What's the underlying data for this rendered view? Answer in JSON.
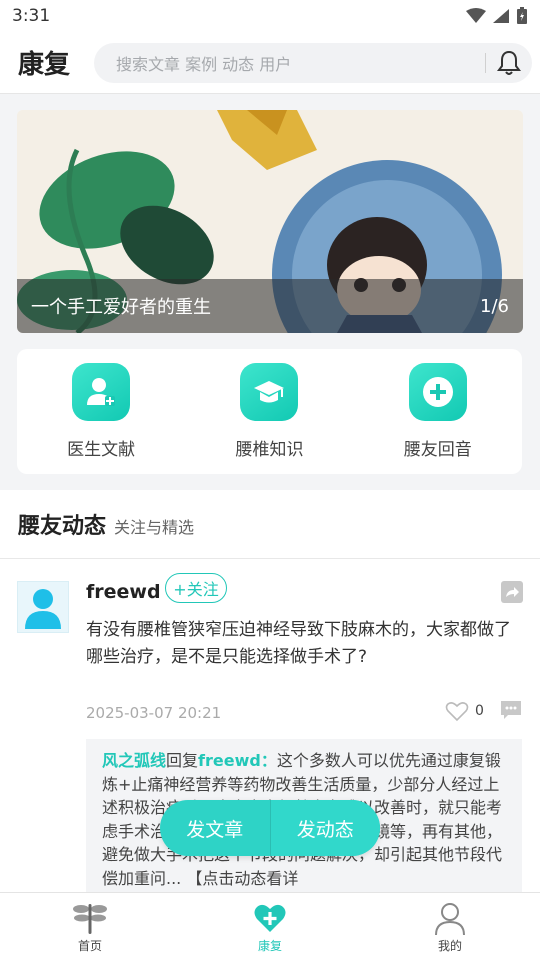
{
  "status": {
    "time": "3:31"
  },
  "header": {
    "brand": "康复",
    "search_placeholder": "搜索文章 案例 动态 用户",
    "bell_icon": "bell-icon"
  },
  "banner": {
    "caption": "一个手工爱好者的重生",
    "index": "1/6"
  },
  "quick": [
    {
      "label": "医生文献",
      "icon": "doctor-icon"
    },
    {
      "label": "腰椎知识",
      "icon": "graduation-cap-icon"
    },
    {
      "label": "腰友回音",
      "icon": "plus-circle-icon"
    }
  ],
  "section": {
    "title": "腰友动态",
    "subtitle": "关注与精选"
  },
  "post": {
    "user": "freewd",
    "follow_label": "+关注",
    "text": "有没有腰椎管狭窄压迫神经导致下肢麻木的，大家都做了哪些治疗，是不是只能选择做手术了?",
    "time": "2025-03-07 20:21",
    "likes": "0",
    "reply": {
      "from": "风之弧线",
      "verb": "回复",
      "to": "freewd",
      "sep": "：",
      "text": "这个多数人可以优先通过康复锻炼+止痛神经营养等药物改善生活质量，少部分人经过上述积极治疗后，疼痛麻木仍然实在难以改善时，就只能考虑手术治疗了，手术有微创，如椎间孔镜等，再有其他，避免做大手术把这个节段的问题解决，却引起其他节段代偿加重问... 【点击动态看详"
    }
  },
  "fab": {
    "left": "发文章",
    "right": "发动态"
  },
  "nav": [
    {
      "label": "首页",
      "icon": "home-dragonfly-icon",
      "active": false
    },
    {
      "label": "康复",
      "icon": "heart-plus-icon",
      "active": true
    },
    {
      "label": "我的",
      "icon": "user-icon",
      "active": false
    }
  ],
  "colors": {
    "accent": "#22c7b8"
  }
}
